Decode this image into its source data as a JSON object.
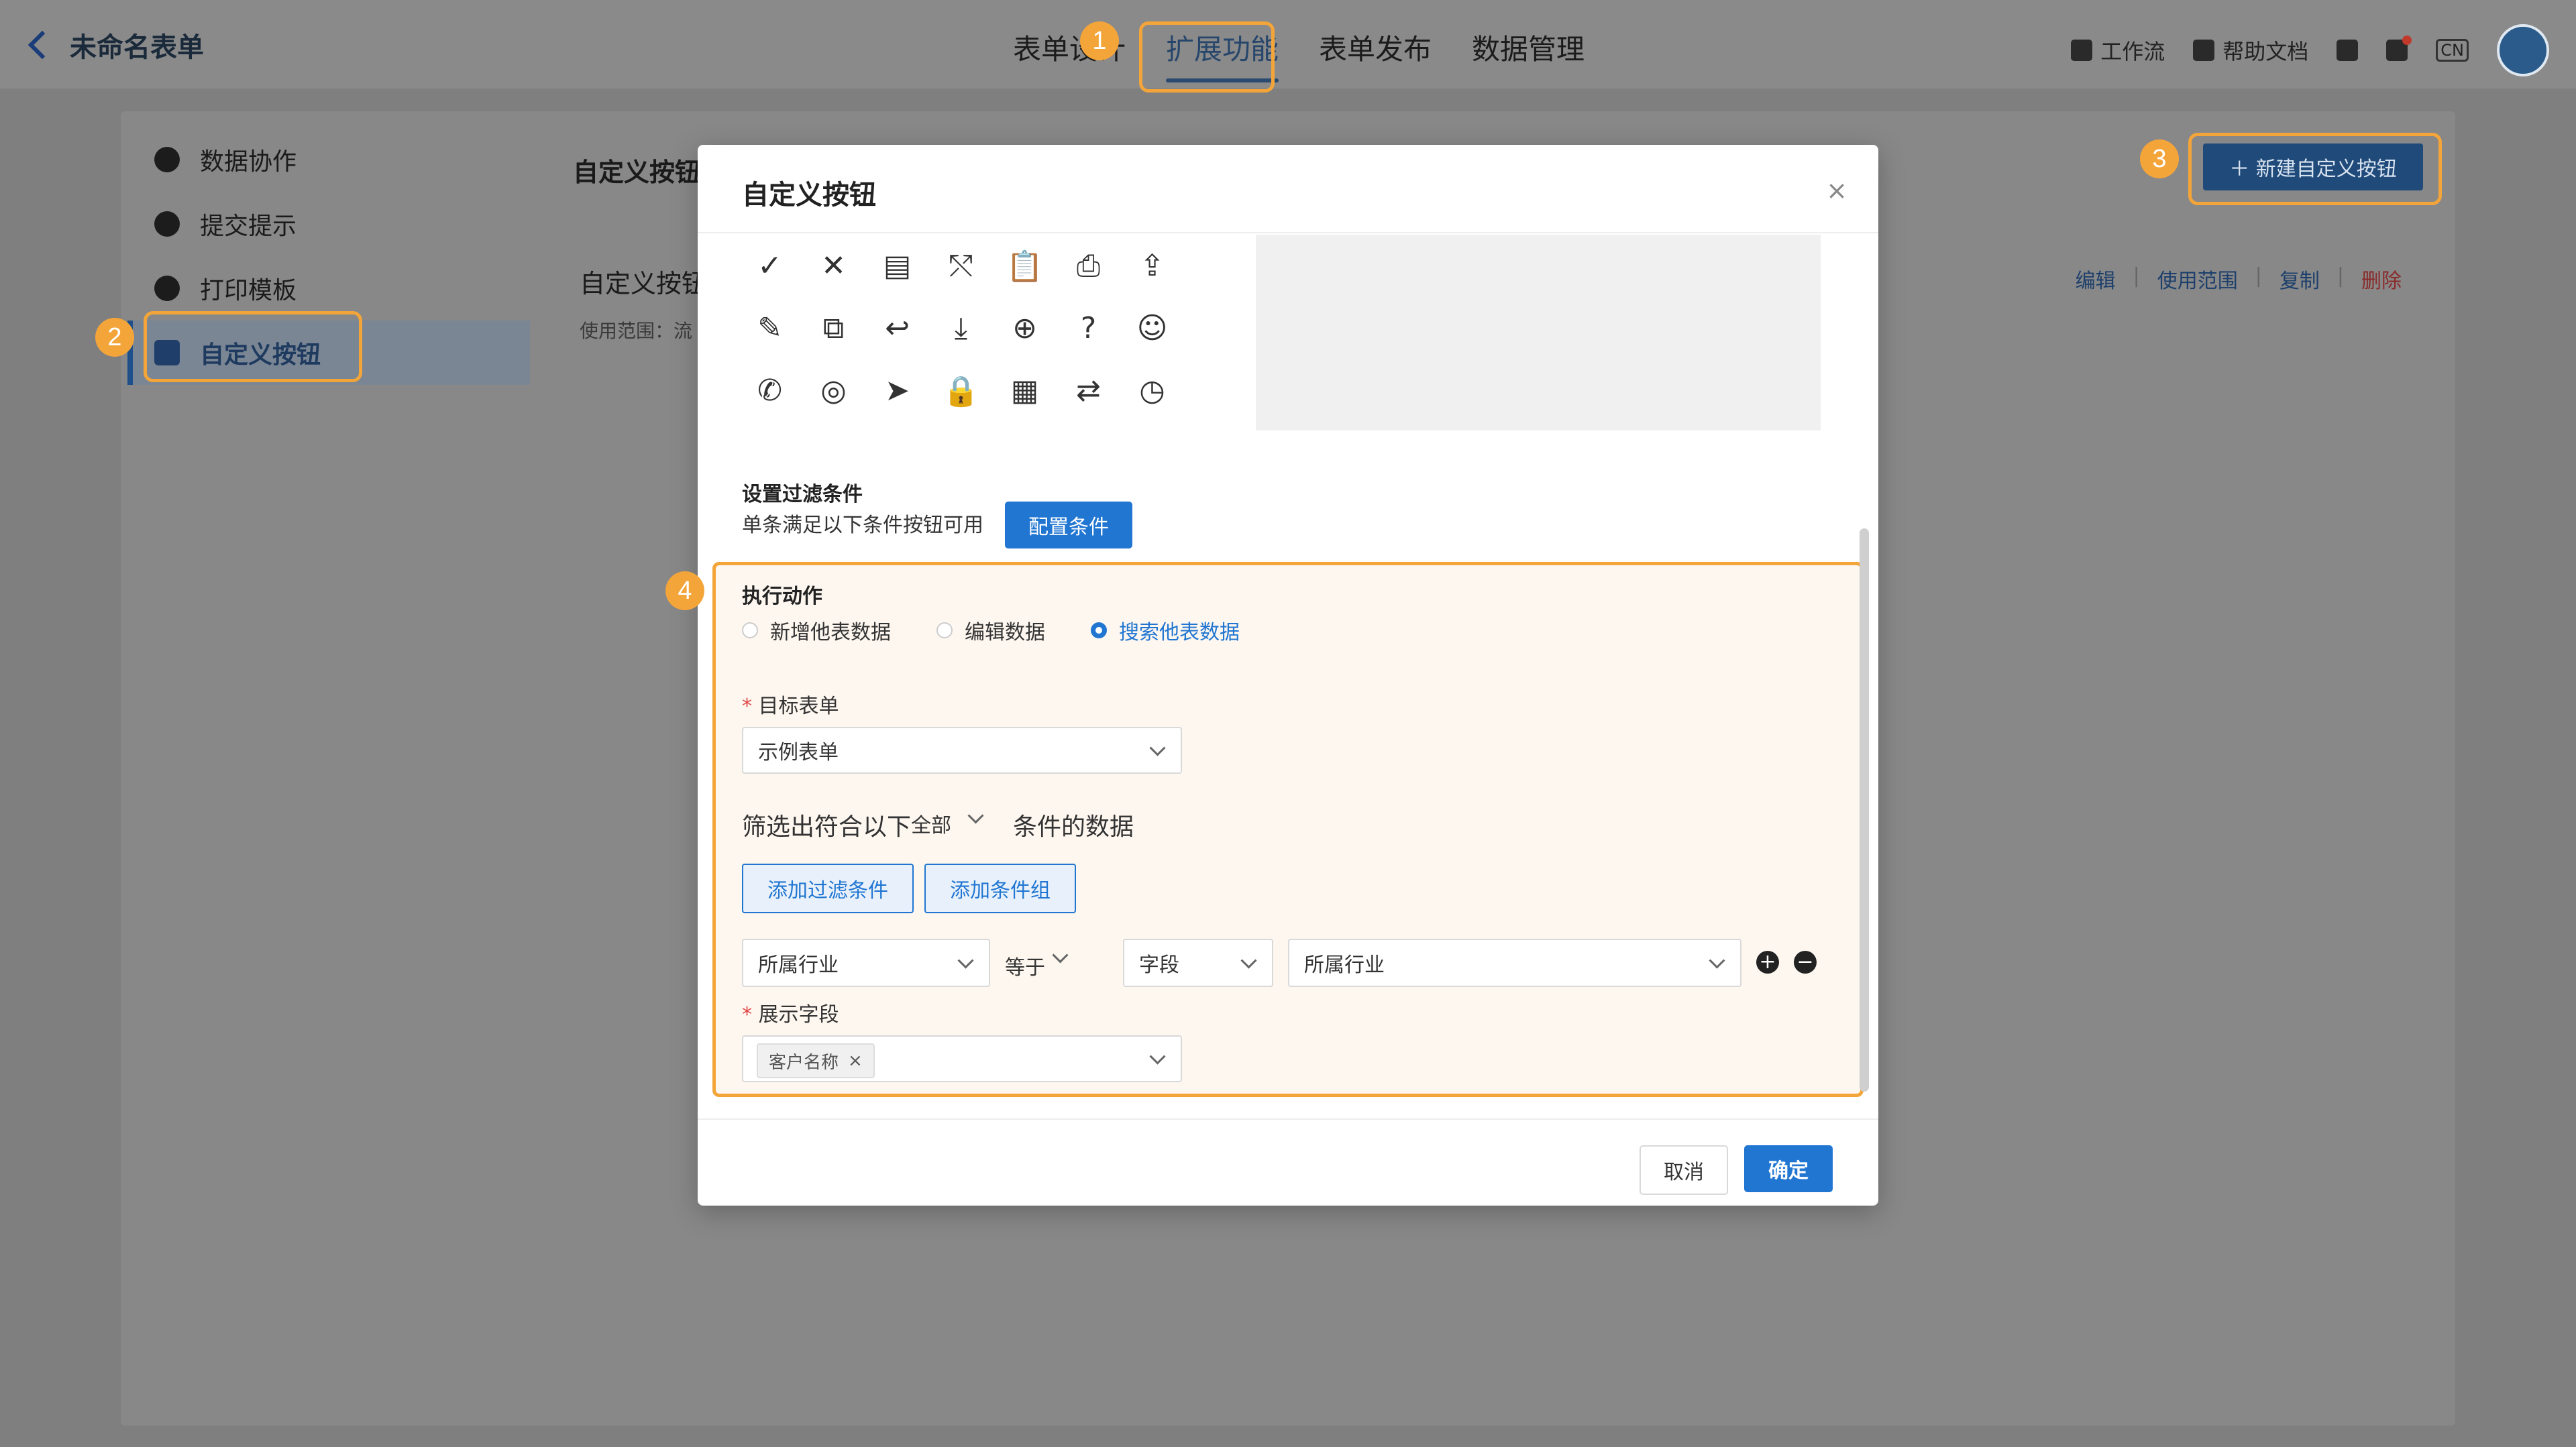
{
  "header": {
    "back_label": "未命名表单",
    "tabs": [
      "表单设计",
      "扩展功能",
      "表单发布",
      "数据管理"
    ],
    "right": {
      "workflow": "工作流",
      "help": "帮助文档",
      "lang": "CN"
    }
  },
  "sidebar": {
    "items": [
      {
        "label": "数据协作",
        "icon": "collaboration-icon"
      },
      {
        "label": "提交提示",
        "icon": "check-circle-icon"
      },
      {
        "label": "打印模板",
        "icon": "printer-icon"
      },
      {
        "label": "自定义按钮",
        "icon": "toggle-icon"
      }
    ]
  },
  "content": {
    "section_title": "自定义按钮",
    "new_button": "＋ 新建自定义按钮",
    "card_title": "自定义按钮",
    "card_sub": "使用范围：流",
    "actions": [
      "编辑",
      "使用范围",
      "复制",
      "删除"
    ]
  },
  "markers": [
    "1",
    "2",
    "3",
    "4"
  ],
  "modal": {
    "title": "自定义按钮",
    "close": "×",
    "icons": [
      "✓",
      "✕",
      "▤",
      "⤲",
      "📋",
      "⎙",
      "⇪",
      "✎",
      "⧉",
      "↩",
      "⤓",
      "⊕",
      "?",
      "☺",
      "✆",
      "◎",
      "➤",
      "🔒",
      "▦",
      "⇄",
      "◷"
    ],
    "filter_section": "设置过滤条件",
    "filter_desc": "单条满足以下条件按钮可用",
    "config_btn": "配置条件",
    "exec_label": "执行动作",
    "radios": [
      "新增他表数据",
      "编辑数据",
      "搜索他表数据"
    ],
    "radio_selected": 2,
    "target_label": "目标表单",
    "target_value": "示例表单",
    "filter_prefix": "筛选出符合以下",
    "filter_scope": "全部",
    "filter_suffix": "条件的数据",
    "add_filter": "添加过滤条件",
    "add_group": "添加条件组",
    "cond": {
      "field": "所属行业",
      "op": "等于",
      "type": "字段",
      "value": "所属行业"
    },
    "display_label": "展示字段",
    "display_tag": "客户名称",
    "cancel": "取消",
    "ok": "确定"
  },
  "colors": {
    "primary": "#2176d2",
    "highlight": "#f4a53a"
  }
}
